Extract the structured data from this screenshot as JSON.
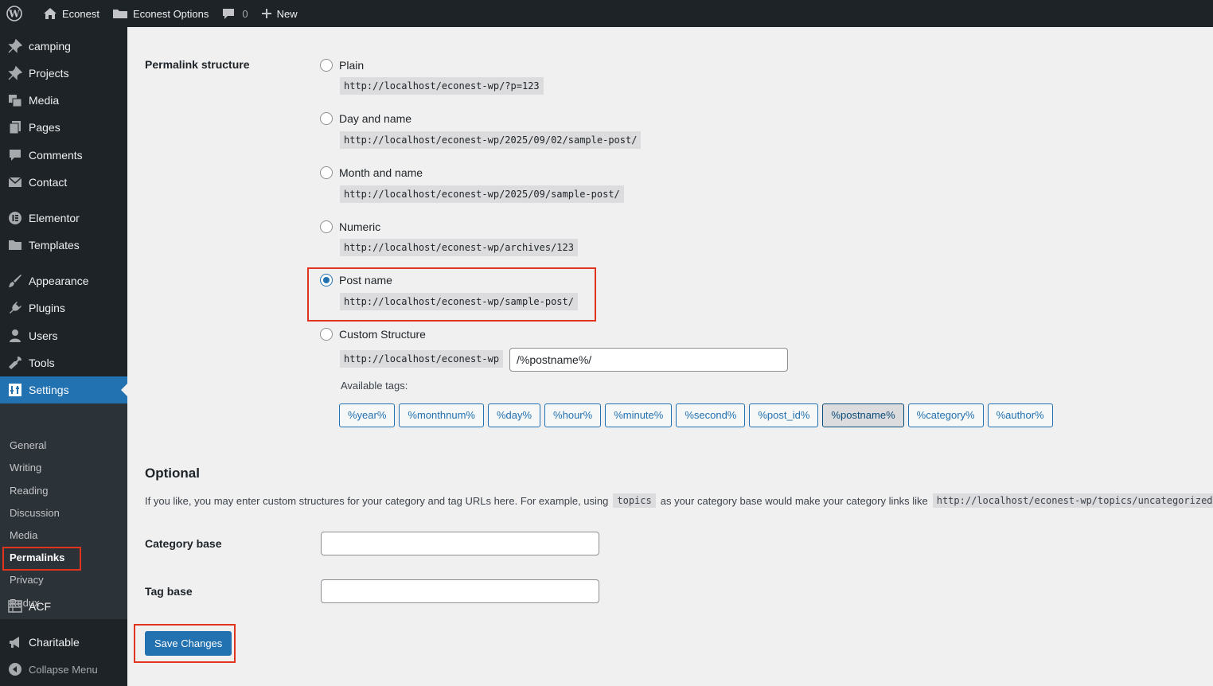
{
  "adminbar": {
    "site_name": "Econest",
    "options_label": "Econest Options",
    "comments_count": "0",
    "new_label": "New"
  },
  "sidebar": {
    "items": [
      {
        "label": "camping",
        "icon": "pin-icon"
      },
      {
        "label": "Projects",
        "icon": "pin-icon"
      },
      {
        "label": "Media",
        "icon": "media-icon"
      },
      {
        "label": "Pages",
        "icon": "pages-icon"
      },
      {
        "label": "Comments",
        "icon": "comment-icon"
      },
      {
        "label": "Contact",
        "icon": "mail-icon"
      },
      {
        "label": "Elementor",
        "icon": "elementor-icon"
      },
      {
        "label": "Templates",
        "icon": "folder-icon"
      },
      {
        "label": "Appearance",
        "icon": "brush-icon"
      },
      {
        "label": "Plugins",
        "icon": "plugin-icon"
      },
      {
        "label": "Users",
        "icon": "user-icon"
      },
      {
        "label": "Tools",
        "icon": "wrench-icon"
      },
      {
        "label": "Settings",
        "icon": "settings-icon"
      }
    ],
    "submenu": [
      "General",
      "Writing",
      "Reading",
      "Discussion",
      "Media",
      "Permalinks",
      "Privacy",
      "Redux"
    ],
    "after": [
      {
        "label": "ACF",
        "icon": "table-icon"
      },
      {
        "label": "Charitable",
        "icon": "megaphone-icon"
      }
    ],
    "collapse_label": "Collapse Menu"
  },
  "permalink": {
    "section_label": "Permalink structure",
    "options": [
      {
        "label": "Plain",
        "example": "http://localhost/econest-wp/?p=123"
      },
      {
        "label": "Day and name",
        "example": "http://localhost/econest-wp/2025/09/02/sample-post/"
      },
      {
        "label": "Month and name",
        "example": "http://localhost/econest-wp/2025/09/sample-post/"
      },
      {
        "label": "Numeric",
        "example": "http://localhost/econest-wp/archives/123"
      },
      {
        "label": "Post name",
        "example": "http://localhost/econest-wp/sample-post/"
      },
      {
        "label": "Custom Structure",
        "example": "http://localhost/econest-wp"
      }
    ],
    "selected": "Post name",
    "custom_value": "/%postname%/",
    "available_tags_label": "Available tags:",
    "tags": [
      "%year%",
      "%monthnum%",
      "%day%",
      "%hour%",
      "%minute%",
      "%second%",
      "%post_id%",
      "%postname%",
      "%category%",
      "%author%"
    ],
    "active_tag": "%postname%"
  },
  "optional": {
    "heading": "Optional",
    "desc_before": "If you like, you may enter custom structures for your category and tag URLs here. For example, using",
    "desc_code1": "topics",
    "desc_middle": "as your category base would make your category links like",
    "desc_code2": "http://localhost/econest-wp/topics/uncategorized/",
    "desc_after": ".",
    "category_label": "Category base",
    "category_value": "",
    "tag_label": "Tag base",
    "tag_value": ""
  },
  "save_label": "Save Changes",
  "colors": {
    "accent": "#2271b1",
    "highlight": "#e0341f",
    "sidebar_bg": "#1d2327"
  }
}
